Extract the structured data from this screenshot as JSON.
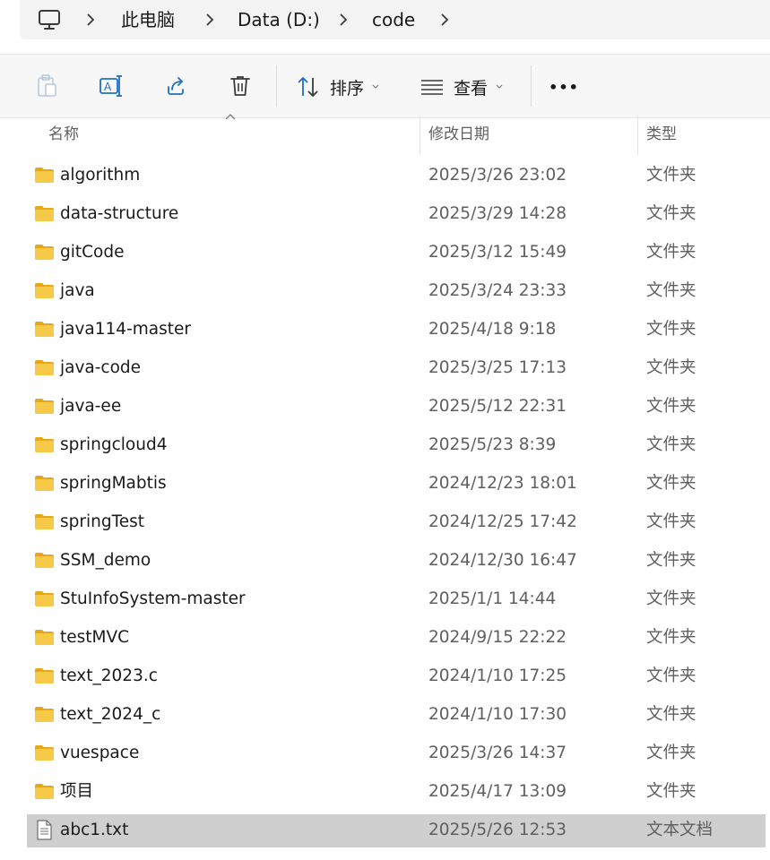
{
  "breadcrumb": {
    "items": [
      "此电脑",
      "Data (D:)",
      "code"
    ],
    "root_icon": "computer-icon"
  },
  "toolbar": {
    "copy_icon": "clipboard-icon",
    "rename_icon": "rename-icon",
    "share_icon": "share-icon",
    "delete_icon": "trash-icon",
    "sort_label": "排序",
    "view_label": "查看",
    "more_label": "•••"
  },
  "columns": {
    "name": "名称",
    "date": "修改日期",
    "type": "类型"
  },
  "files": [
    {
      "name": "algorithm",
      "date": "2025/3/26 23:02",
      "type": "文件夹",
      "icon": "folder-icon"
    },
    {
      "name": "data-structure",
      "date": "2025/3/29 14:28",
      "type": "文件夹",
      "icon": "folder-icon"
    },
    {
      "name": "gitCode",
      "date": "2025/3/12 15:49",
      "type": "文件夹",
      "icon": "folder-icon"
    },
    {
      "name": "java",
      "date": "2025/3/24 23:33",
      "type": "文件夹",
      "icon": "folder-icon"
    },
    {
      "name": "java114-master",
      "date": "2025/4/18 9:18",
      "type": "文件夹",
      "icon": "folder-icon"
    },
    {
      "name": "java-code",
      "date": "2025/3/25 17:13",
      "type": "文件夹",
      "icon": "folder-icon"
    },
    {
      "name": "java-ee",
      "date": "2025/5/12 22:31",
      "type": "文件夹",
      "icon": "folder-icon"
    },
    {
      "name": "springcloud4",
      "date": "2025/5/23 8:39",
      "type": "文件夹",
      "icon": "folder-icon"
    },
    {
      "name": "springMabtis",
      "date": "2024/12/23 18:01",
      "type": "文件夹",
      "icon": "folder-icon"
    },
    {
      "name": "springTest",
      "date": "2024/12/25 17:42",
      "type": "文件夹",
      "icon": "folder-icon"
    },
    {
      "name": "SSM_demo",
      "date": "2024/12/30 16:47",
      "type": "文件夹",
      "icon": "folder-icon"
    },
    {
      "name": "StuInfoSystem-master",
      "date": "2025/1/1 14:44",
      "type": "文件夹",
      "icon": "folder-icon"
    },
    {
      "name": "testMVC",
      "date": "2024/9/15 22:22",
      "type": "文件夹",
      "icon": "folder-icon"
    },
    {
      "name": "text_2023.c",
      "date": "2024/1/10 17:25",
      "type": "文件夹",
      "icon": "folder-icon"
    },
    {
      "name": "text_2024_c",
      "date": "2024/1/10 17:30",
      "type": "文件夹",
      "icon": "folder-icon"
    },
    {
      "name": "vuespace",
      "date": "2025/3/26 14:37",
      "type": "文件夹",
      "icon": "folder-icon"
    },
    {
      "name": "项目",
      "date": "2025/4/17 13:09",
      "type": "文件夹",
      "icon": "folder-icon"
    },
    {
      "name": "abc1.txt",
      "date": "2025/5/26 12:53",
      "type": "文本文档",
      "icon": "text-file-icon",
      "selected": true
    }
  ],
  "colors": {
    "folder": "#f7c948",
    "folder_dark": "#e6a817",
    "accent": "#1f6fc5",
    "selected_row": "#cfcfcf"
  }
}
